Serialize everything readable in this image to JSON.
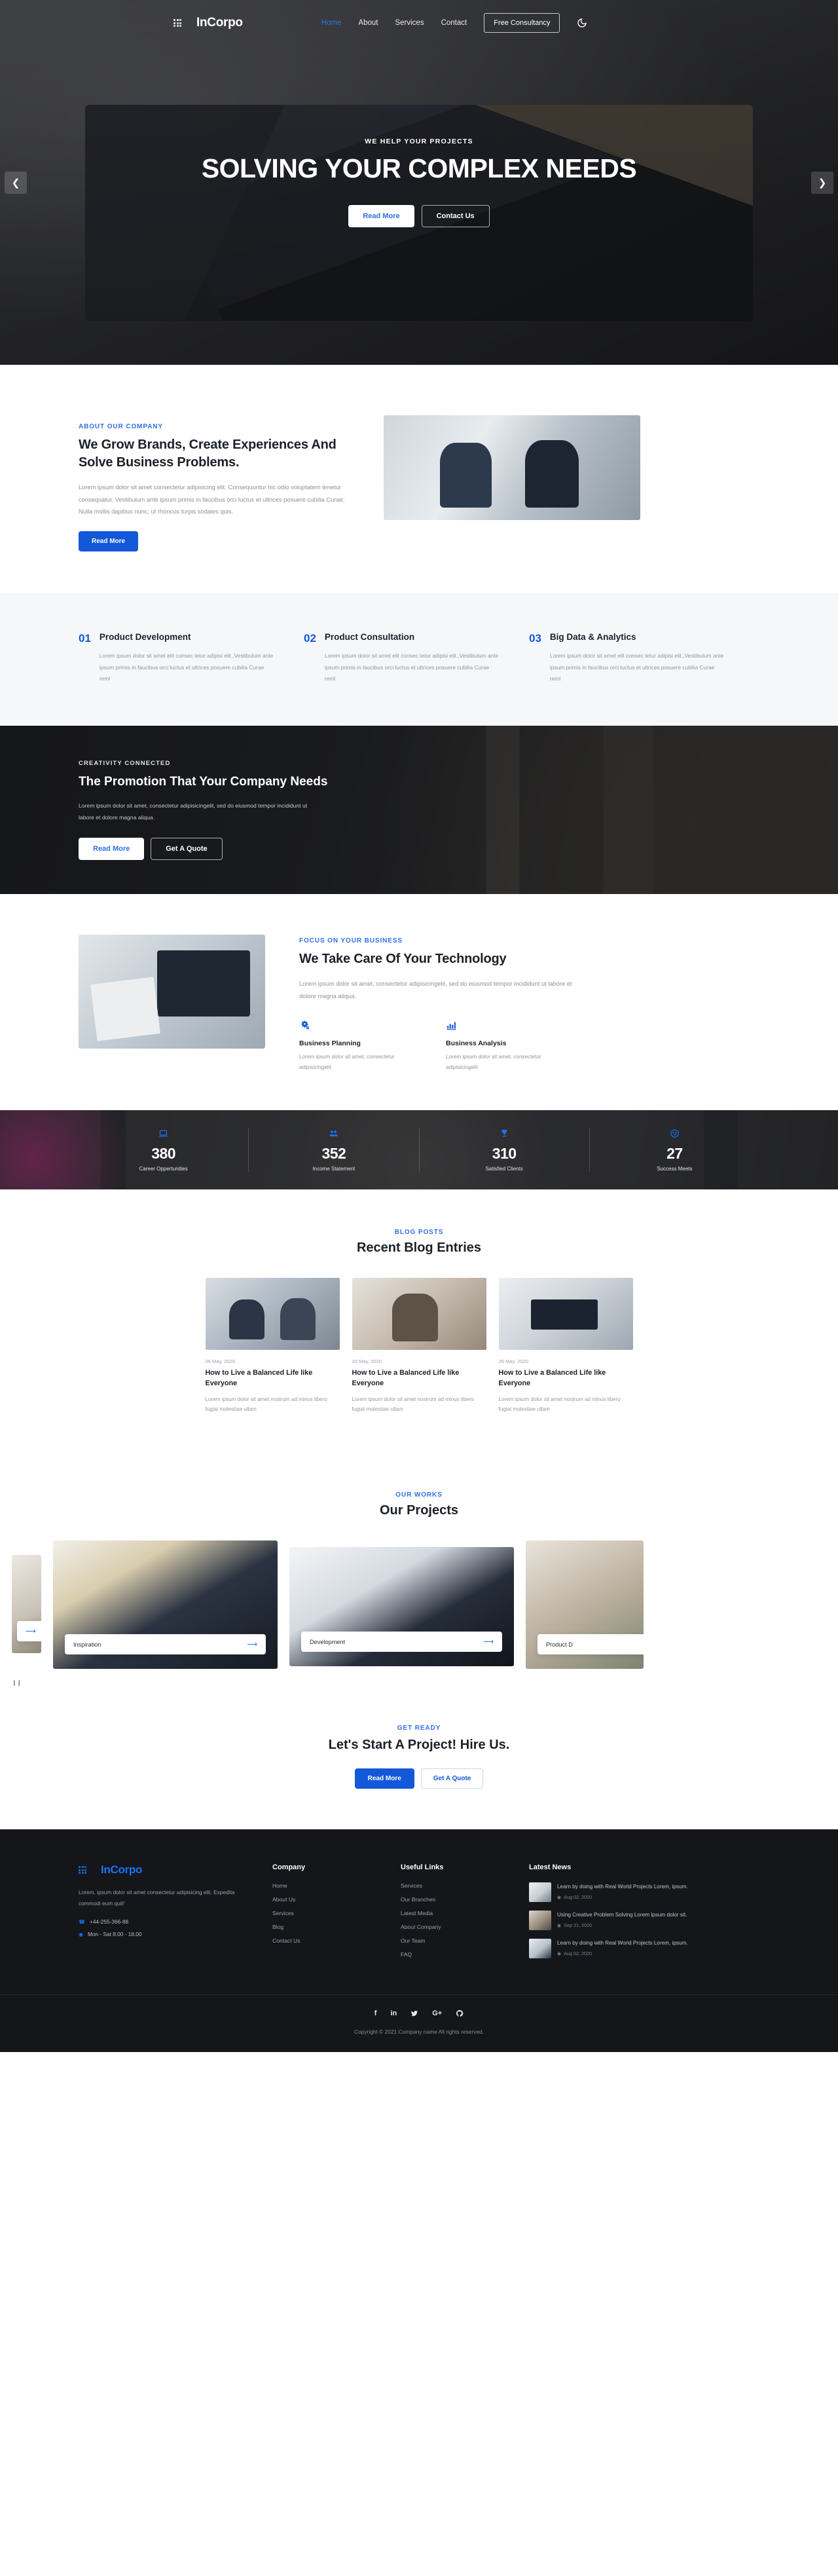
{
  "brand": {
    "name": "InCorpo"
  },
  "header": {
    "nav": [
      {
        "label": "Home",
        "active": true
      },
      {
        "label": "About",
        "active": false
      },
      {
        "label": "Services",
        "active": false
      },
      {
        "label": "Contact",
        "active": false
      }
    ],
    "cta_label": "Free Consultancy",
    "theme_icon": "moon-icon"
  },
  "hero": {
    "kicker": "WE HELP YOUR PROJECTS",
    "title": "SOLVING YOUR COMPLEX NEEDS",
    "primary_btn": "Read More",
    "secondary_btn": "Contact Us",
    "prev_icon": "chevron-left-icon",
    "next_icon": "chevron-right-icon"
  },
  "about": {
    "kicker": "ABOUT OUR COMPANY",
    "title": "We Grow Brands, Create Experiences And Solve Business Problems.",
    "paragraph": "Lorem ipsum dolor sit amet consectetur adipisicing elit. Consequuntur hic odio voluptatem tenetur consequatur. Vestibulum ante ipsum primis in faucibus orci luctus et ultrices posuere cubilia Curae; Nulla mollis dapibus nunc, ut rhoncus turpis sodales quis.",
    "button": "Read More"
  },
  "services": [
    {
      "num": "01",
      "title": "Product Development",
      "text": "Lorem ipsum dolor sit amet elit consec tetur adipisi elit.,Vestibulum ante ipsum primis in faucibus orci luctus et ultrices posuere cubilia Curae reml"
    },
    {
      "num": "02",
      "title": "Product Consultation",
      "text": "Lorem ipsum dolor sit amet elit consec tetur adipisi elit.,Vestibulum ante ipsum primis in faucibus orci luctus et ultrices posuere cubilia Curae reml"
    },
    {
      "num": "03",
      "title": "Big Data & Analytics",
      "text": "Lorem ipsum dolor sit amet elit consec tetur adipisi elit.,Vestibulum ante ipsum primis in faucibus orci luctus et ultrices posuere cubilia Curae reml"
    }
  ],
  "promo": {
    "kicker": "CREATIVITY CONNECTED",
    "title": "The Promotion That Your Company Needs",
    "paragraph": "Lorem ipsum dolor sit amet, consectetur adipisicingelit, sed do eiusmod tempor incididunt ut labore et dolore magna aliqua.",
    "primary_btn": "Read More",
    "secondary_btn": "Get A Quote"
  },
  "tech": {
    "kicker": "FOCUS ON YOUR BUSINESS",
    "title": "We Take Care Of Your Technology",
    "paragraph": "Lorem ipsum dolor sit amet, consectetur adipisicingelit, sed do eiusmod tempor incididunt ut labore et dolore magna aliqua.",
    "features": [
      {
        "icon": "gears-icon",
        "title": "Business Planning",
        "text": "Lorem ipsum dolor sit amet, consectetur adipisicingelit"
      },
      {
        "icon": "bar-chart-icon",
        "title": "Business Analysis",
        "text": "Lorem ipsum dolor sit amet, consectetur adipisicingelit"
      }
    ]
  },
  "counters": [
    {
      "icon": "laptop-icon",
      "value": "380",
      "label": "Career Oppertunities"
    },
    {
      "icon": "users-icon",
      "value": "352",
      "label": "Income Statement"
    },
    {
      "icon": "trophy-icon",
      "value": "310",
      "label": "Satisfied Clients"
    },
    {
      "icon": "smiley-icon",
      "value": "27",
      "label": "Success Meets"
    }
  ],
  "blog": {
    "kicker": "BLOG POSTS",
    "title": "Recent Blog Entries",
    "posts": [
      {
        "date": "06 May, 2020",
        "title": "How to Live a Balanced Life like Everyone",
        "excerpt": "Lorem ipsum dolor sit amet nostrum ad minus libero fugiat molestiae ullam"
      },
      {
        "date": "20 May, 2020",
        "title": "How to Live a Balanced Life like Everyone",
        "excerpt": "Lorem ipsum dolor sit amet nostrum ad minus libero fugiat molestiae ullam"
      },
      {
        "date": "26 May, 2020",
        "title": "How to Live a Balanced Life like Everyone",
        "excerpt": "Lorem ipsum dolor sit amet nostrum ad minus libero fugiat molestiae ullam"
      }
    ]
  },
  "projects": {
    "kicker": "OUR WORKS",
    "title": "Our Projects",
    "items": [
      {
        "label": "Inspiration",
        "arrow": "arrow-right-icon"
      },
      {
        "label": "Development",
        "arrow": "arrow-right-icon"
      },
      {
        "label": "Product D",
        "arrow": "arrow-right-icon"
      }
    ],
    "pause_icon": "pause-icon"
  },
  "cta": {
    "kicker": "GET READY",
    "title": "Let's Start A Project! Hire Us.",
    "primary_btn": "Read More",
    "secondary_btn": "Get A Quote"
  },
  "footer": {
    "about_text": "Lorem, ipsum dolor sit amet consectetur adipisicing elit. Expedita commodi eum quiI!",
    "phone": "+44-255-366-88",
    "hours": "Mon - Sat 8.00 - 18.00",
    "phone_icon": "phone-icon",
    "clock_icon": "clock-icon",
    "company": {
      "heading": "Company",
      "links": [
        "Home",
        "About Us",
        "Services",
        "Blog",
        "Contact Us"
      ]
    },
    "useful": {
      "heading": "Useful Links",
      "links": [
        "Services",
        "Our Branches",
        "Latest Media",
        "About Company",
        "Our Team",
        "FAQ"
      ]
    },
    "news": {
      "heading": "Latest News",
      "items": [
        {
          "title": "Learn by doing with Real World Projects Lorem, ipsum.",
          "date": "Aug 02, 2020"
        },
        {
          "title": "Using Creative Problem Solving Lorem ipsum dolor sit.",
          "date": "Sep 21, 2020"
        },
        {
          "title": "Learn by doing with Real World Projects Lorem, ipsum.",
          "date": "Aug 02, 2020"
        }
      ]
    },
    "socials": [
      {
        "name": "facebook-icon",
        "glyph": "f"
      },
      {
        "name": "linkedin-icon",
        "glyph": "in"
      },
      {
        "name": "twitter-icon",
        "glyph": "✉"
      },
      {
        "name": "google-plus-icon",
        "glyph": "G+"
      },
      {
        "name": "github-icon",
        "glyph": "Ⓖ"
      }
    ],
    "copyright": "Copyright © 2021.Company name All rights reserved."
  },
  "colors": {
    "accent": "#1358d8",
    "accent_light": "#2f6fe4",
    "dark": "#14161a"
  }
}
